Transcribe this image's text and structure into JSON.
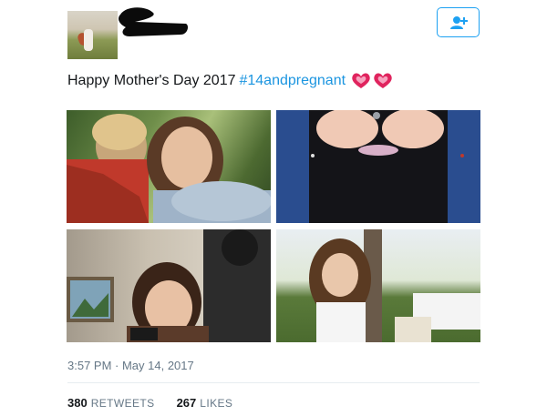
{
  "tweet": {
    "text": "Happy Mother's Day 2017",
    "hashtag": "#14andpregnant",
    "emoji": [
      "two-hearts-icon",
      "two-hearts-icon"
    ],
    "timestamp": "3:57 PM · May 14, 2017"
  },
  "stats": {
    "retweets_count": "380",
    "retweets_label": "RETWEETS",
    "likes_count": "267",
    "likes_label": "LIKES"
  },
  "colors": {
    "accent": "#1da1f2",
    "hashtag": "#1b95e0",
    "muted": "#657786",
    "heart": "#e0245e"
  },
  "icons": {
    "follow": "add-user-icon"
  }
}
